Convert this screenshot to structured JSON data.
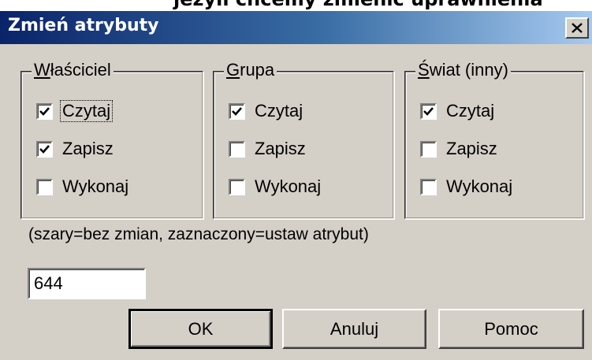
{
  "top_clip_text": "jeżyli chcemy zmienić uprawnienia",
  "window": {
    "title": "Zmień atrybuty",
    "close_glyph": "✕"
  },
  "groups": [
    {
      "name": "Właściciel",
      "accel": "W",
      "title_rest": "łaściciel",
      "items": [
        {
          "label": "Czytaj",
          "checked": true
        },
        {
          "label": "Zapisz",
          "checked": true
        },
        {
          "label": "Wykonaj",
          "checked": false
        }
      ]
    },
    {
      "name": "Grupa",
      "accel": "G",
      "title_rest": "rupa",
      "items": [
        {
          "label": "Czytaj",
          "checked": true
        },
        {
          "label": "Zapisz",
          "checked": false
        },
        {
          "label": "Wykonaj",
          "checked": false
        }
      ]
    },
    {
      "name": "Świat (inny)",
      "accel": "Ś",
      "title_rest": "wiat (inny)",
      "items": [
        {
          "label": "Czytaj",
          "checked": true
        },
        {
          "label": "Zapisz",
          "checked": false
        },
        {
          "label": "Wykonaj",
          "checked": false
        }
      ]
    }
  ],
  "hint": "(szary=bez zmian, zaznaczony=ustaw atrybut)",
  "octal_value": "644",
  "buttons": {
    "ok": "OK",
    "cancel": "Anuluj",
    "help": "Pomoc"
  },
  "colors": {
    "title_gradient_start": "#0a246a",
    "title_gradient_end": "#a6caf0",
    "dialog_face": "#d4d0c8"
  },
  "icons": {
    "close": "close-icon",
    "check": "checkmark-icon"
  }
}
